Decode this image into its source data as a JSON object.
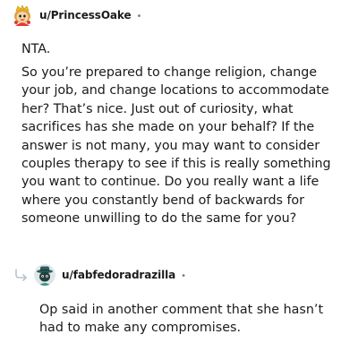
{
  "comment": {
    "username": "u/PrincessOake",
    "separator": "•",
    "avatar": "avatar-princess-oake",
    "paragraphs": [
      "NTA.",
      "So you’re prepared to change religion, change your job, and change locations to accommodate her? That’s nice. Just out of curiosity, what sacrifices has she made on your behalf? If the answer is not many, you may want to consider couples therapy to see if this is really something you want to continue. Do you really want a life where you constantly bend of backwards for someone unwilling to do the same for you?"
    ]
  },
  "reply": {
    "icon": "reply-arrow-icon",
    "username": "u/fabfedoradrazilla",
    "separator": "•",
    "avatar": "avatar-fabfedoradrazilla",
    "text": "Op said in another comment that she hasn’t had to make any compromises."
  },
  "colors": {
    "text": "#1a1a1b",
    "meta": "#7c7c7c",
    "reply_arrow": "#b8c5d0"
  }
}
